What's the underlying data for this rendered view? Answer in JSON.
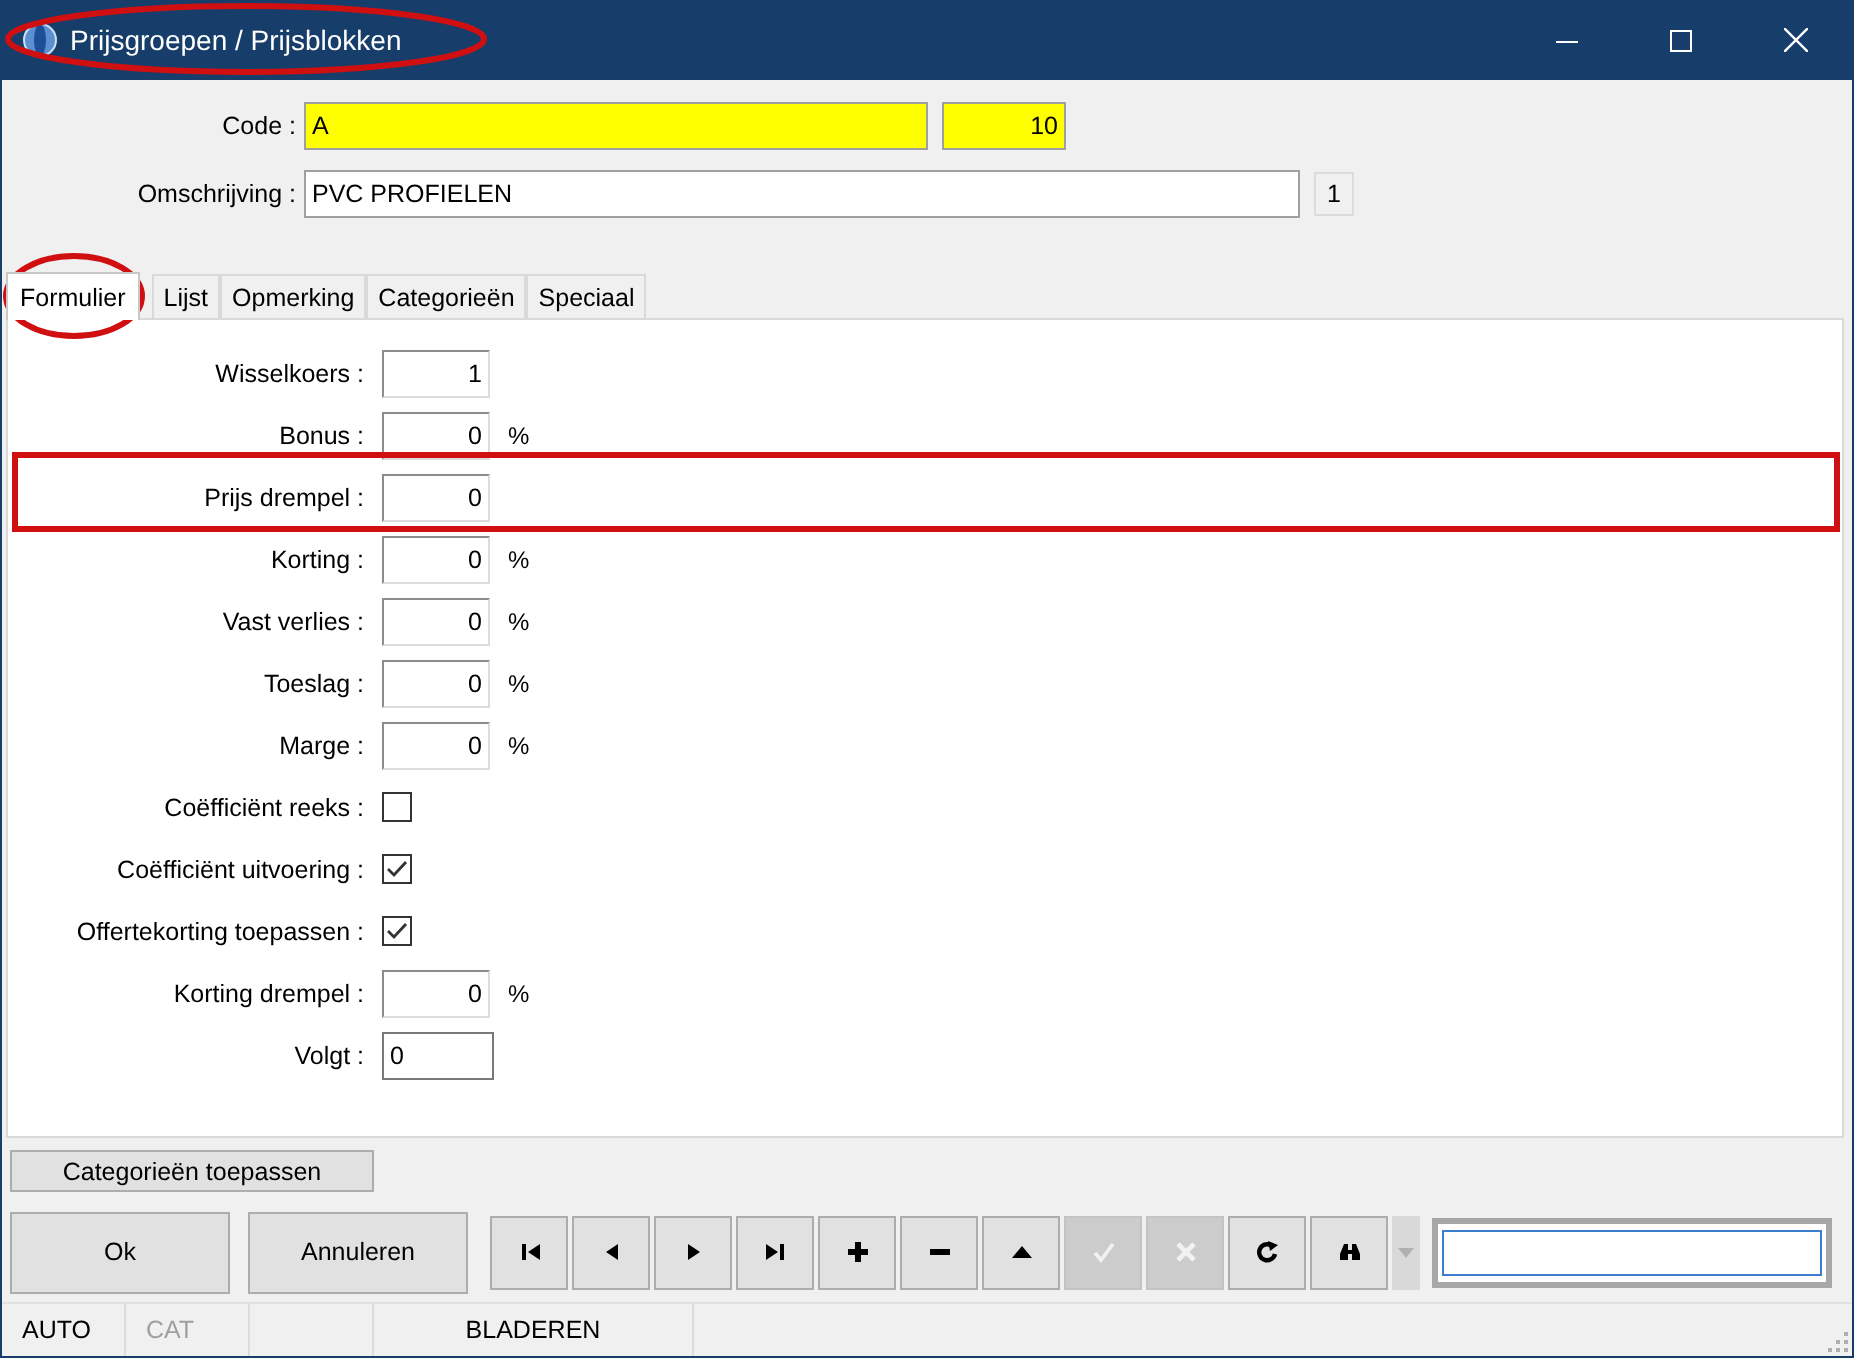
{
  "window": {
    "title": "Prijsgroepen / Prijsblokken"
  },
  "code": {
    "label": "Code :",
    "value": "A",
    "number": "10"
  },
  "description": {
    "label": "Omschrijving :",
    "value": "PVC PROFIELEN",
    "counter": "1"
  },
  "tabs": [
    {
      "label": "Formulier",
      "selected": true
    },
    {
      "label": "Lijst",
      "selected": false
    },
    {
      "label": "Opmerking",
      "selected": false
    },
    {
      "label": "Categorieën",
      "selected": false
    },
    {
      "label": "Speciaal",
      "selected": false
    }
  ],
  "form_rows": [
    {
      "kind": "number",
      "label": "Wisselkoers :",
      "value": "1"
    },
    {
      "kind": "number",
      "label": "Bonus :",
      "value": "0",
      "unit": "%"
    },
    {
      "kind": "number",
      "label": "Prijs drempel :",
      "value": "0"
    },
    {
      "kind": "number",
      "label": "Korting :",
      "value": "0",
      "unit": "%"
    },
    {
      "kind": "number",
      "label": "Vast verlies :",
      "value": "0",
      "unit": "%"
    },
    {
      "kind": "number",
      "label": "Toeslag :",
      "value": "0",
      "unit": "%"
    },
    {
      "kind": "number",
      "label": "Marge :",
      "value": "0",
      "unit": "%"
    },
    {
      "kind": "checkbox",
      "label": "Coëfficiënt reeks :",
      "checked": false
    },
    {
      "kind": "checkbox",
      "label": "Coëfficiënt uitvoering :",
      "checked": true
    },
    {
      "kind": "checkbox",
      "label": "Offertekorting toepassen :",
      "checked": true
    },
    {
      "kind": "number",
      "label": "Korting drempel :",
      "value": "0",
      "unit": "%"
    },
    {
      "kind": "text",
      "label": "Volgt :",
      "value": "0"
    }
  ],
  "apply_button": "Categorieën toepassen",
  "buttons": [
    "Ok",
    "Annuleren"
  ],
  "toolbar": [
    {
      "kind": "first",
      "disabled": false
    },
    {
      "kind": "prev",
      "disabled": false
    },
    {
      "kind": "next",
      "disabled": false
    },
    {
      "kind": "last",
      "disabled": false
    },
    {
      "kind": "add",
      "disabled": false
    },
    {
      "kind": "remove",
      "disabled": false
    },
    {
      "kind": "up",
      "disabled": false
    },
    {
      "kind": "confirm",
      "disabled": true
    },
    {
      "kind": "cancel",
      "disabled": true
    },
    {
      "kind": "refresh",
      "disabled": false
    },
    {
      "kind": "find",
      "disabled": false
    },
    {
      "kind": "dropdown",
      "disabled": true
    }
  ],
  "status_bar": [
    {
      "kind": "text",
      "text": "AUTO",
      "disabled": false
    },
    {
      "kind": "text",
      "text": "CAT",
      "disabled": true
    },
    {
      "kind": "empty"
    },
    {
      "kind": "text",
      "text": "BLADEREN",
      "disabled": false
    }
  ]
}
